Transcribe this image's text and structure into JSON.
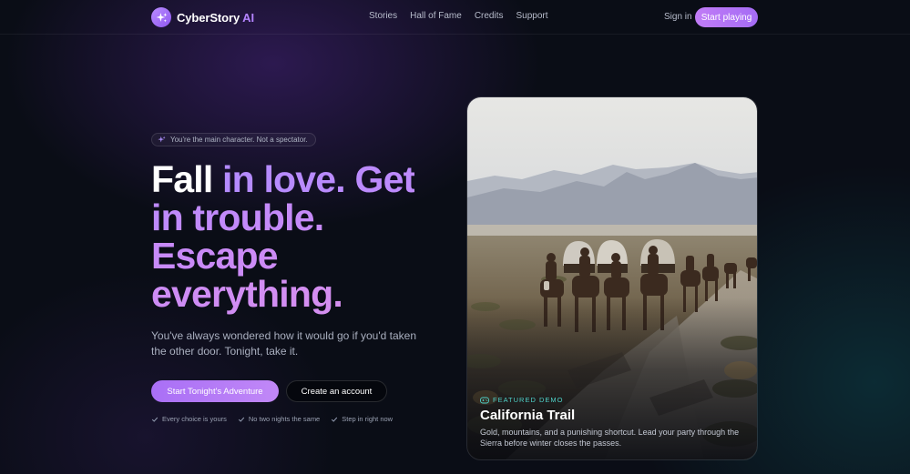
{
  "brand": {
    "name": "CyberStory",
    "accent": "AI",
    "icon": "sparkles-icon"
  },
  "nav": {
    "links": [
      "Stories",
      "Hall of Fame",
      "Credits",
      "Support"
    ]
  },
  "header": {
    "sign_in": "Sign in",
    "cta": "Start playing"
  },
  "hero": {
    "tag": "You're the main character. Not a spectator.",
    "headline_white": "Fall",
    "headline_gradient": "in love. Get in trouble. Escape everything.",
    "subtext": "You've always wondered how it would go if you'd taken the other door. Tonight, take it.",
    "primary_button": "Start Tonight's Adventure",
    "secondary_button": "Create an account",
    "checks": [
      "Every choice is yours",
      "No two nights the same",
      "Step in right now"
    ]
  },
  "card": {
    "label": "Featured Demo",
    "title": "California Trail",
    "description": "Gold, mountains, and a punishing shortcut. Lead your party through the Sierra before winter closes the passes."
  },
  "colors": {
    "accent": "#b483ff",
    "teal": "#4fd1c8",
    "background": "#0a0d16"
  }
}
